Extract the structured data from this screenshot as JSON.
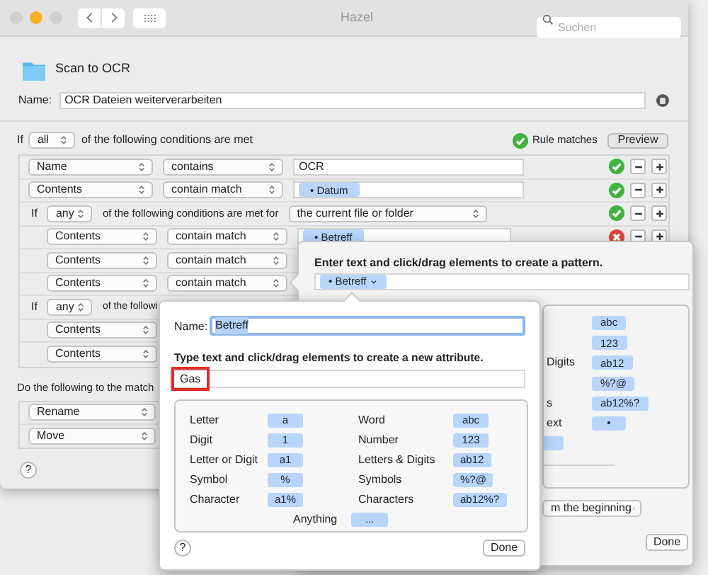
{
  "window": {
    "title": "Hazel",
    "search": {
      "placeholder": "Suchen"
    }
  },
  "folder": {
    "name": "Scan to OCR"
  },
  "rule_name": {
    "label": "Name:",
    "value": "OCR Dateien weiterverarbeiten"
  },
  "conditions_header": {
    "prefix": "If",
    "match": "all",
    "suffix": "of the following conditions are met",
    "status": "Rule matches",
    "preview_button": "Preview"
  },
  "conditions": [
    {
      "kind": "condition",
      "attribute": "Name",
      "operator": "contains",
      "value": "OCR",
      "matches": true
    },
    {
      "kind": "condition",
      "attribute": "Contents",
      "operator": "contain match",
      "token": "• Datum",
      "matches": true
    },
    {
      "kind": "group",
      "prefix": "If",
      "match": "any",
      "text": "of the following conditions are met for",
      "target": "the current file or folder",
      "matches": true,
      "children": [
        {
          "kind": "condition",
          "attribute": "Contents",
          "operator": "contain match",
          "token": "• Betreff",
          "matches": false
        },
        {
          "kind": "condition",
          "attribute": "Contents",
          "operator": "contain match"
        },
        {
          "kind": "condition",
          "attribute": "Contents",
          "operator": "contain match"
        }
      ]
    },
    {
      "kind": "group",
      "prefix": "If",
      "match": "any",
      "text": "of the followi",
      "children": [
        {
          "kind": "condition",
          "attribute": "Contents"
        },
        {
          "kind": "condition",
          "attribute": "Contents"
        }
      ]
    }
  ],
  "actions_label": "Do the following to the match",
  "actions": [
    {
      "action": "Rename"
    },
    {
      "action": "Move"
    }
  ],
  "help_button": "?",
  "pattern_popover": {
    "instruction": "Enter text and click/drag elements to create a pattern.",
    "tokens": [
      {
        "label": "• Betreff",
        "menu": true
      }
    ],
    "palette": [
      {
        "kind": "element",
        "chip": "abc"
      },
      {
        "kind": "element",
        "chip": "123"
      },
      {
        "kind": "element",
        "label": "Digits",
        "chip": "ab12"
      },
      {
        "kind": "element",
        "chip": "%?@"
      },
      {
        "kind": "element",
        "label": "s",
        "chip": "ab12%?"
      },
      {
        "kind": "element",
        "label": "ext",
        "chip": "•"
      },
      {
        "kind": "blank"
      }
    ],
    "position_popup": "m the beginning",
    "done_button": "Done"
  },
  "attribute_popover": {
    "name_label": "Name:",
    "name_value": "Betreff",
    "name_selected": true,
    "instruction": "Type text and click/drag elements to create a new attribute.",
    "pattern_value": "Gas",
    "pattern_highlighted": true,
    "palette": [
      {
        "kind": "element",
        "label": "Letter",
        "chip": "a"
      },
      {
        "kind": "element",
        "label": "Word",
        "chip": "abc"
      },
      {
        "kind": "element",
        "label": "Digit",
        "chip": "1"
      },
      {
        "kind": "element",
        "label": "Number",
        "chip": "123"
      },
      {
        "kind": "element",
        "label": "Letter or Digit",
        "chip": "a1"
      },
      {
        "kind": "element",
        "label": "Letters & Digits",
        "chip": "ab12"
      },
      {
        "kind": "element",
        "label": "Symbol",
        "chip": "%"
      },
      {
        "kind": "element",
        "label": "Symbols",
        "chip": "%?@"
      },
      {
        "kind": "element",
        "label": "Character",
        "chip": "a1%"
      },
      {
        "kind": "element",
        "label": "Characters",
        "chip": "ab12%?"
      },
      {
        "kind": "wide",
        "label": "Anything",
        "chip": "..."
      }
    ],
    "help_button": "?",
    "done_button": "Done"
  }
}
